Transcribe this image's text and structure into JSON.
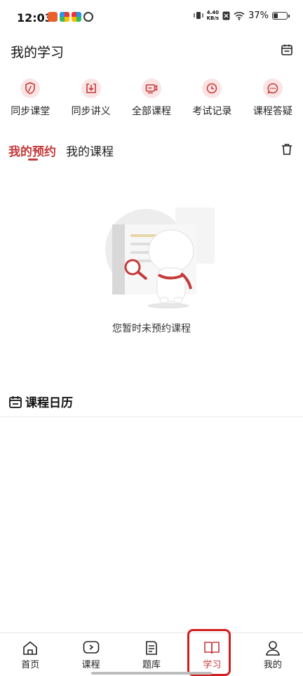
{
  "status_bar": {
    "time": "12:03",
    "net_speed_value": "4.40",
    "net_speed_unit": "KB/s",
    "battery": "37%"
  },
  "header": {
    "title": "我的学习",
    "calendar_icon": "calendar-icon"
  },
  "quick_actions": [
    {
      "label": "同步课堂",
      "icon": "shield-pen-icon"
    },
    {
      "label": "同步讲义",
      "icon": "download-doc-icon"
    },
    {
      "label": "全部课程",
      "icon": "video-course-icon"
    },
    {
      "label": "考试记录",
      "icon": "clock-icon"
    },
    {
      "label": "课程答疑",
      "icon": "chat-bubble-icon"
    }
  ],
  "tabs": {
    "active": "我的预约",
    "inactive": "我的课程"
  },
  "empty_state": {
    "text": "您暂时未预约课程"
  },
  "calendar_section": {
    "title": "课程日历"
  },
  "bottom_nav": [
    {
      "label": "首页",
      "icon": "home-icon",
      "active": false
    },
    {
      "label": "课程",
      "icon": "play-screen-icon",
      "active": false
    },
    {
      "label": "题库",
      "icon": "question-bank-icon",
      "active": false
    },
    {
      "label": "学习",
      "icon": "open-book-icon",
      "active": true
    },
    {
      "label": "我的",
      "icon": "user-icon",
      "active": false
    }
  ],
  "colors": {
    "accent": "#c53a3a",
    "highlight_box": "#d11f1f",
    "icon_bg": "#fbe4e4"
  }
}
